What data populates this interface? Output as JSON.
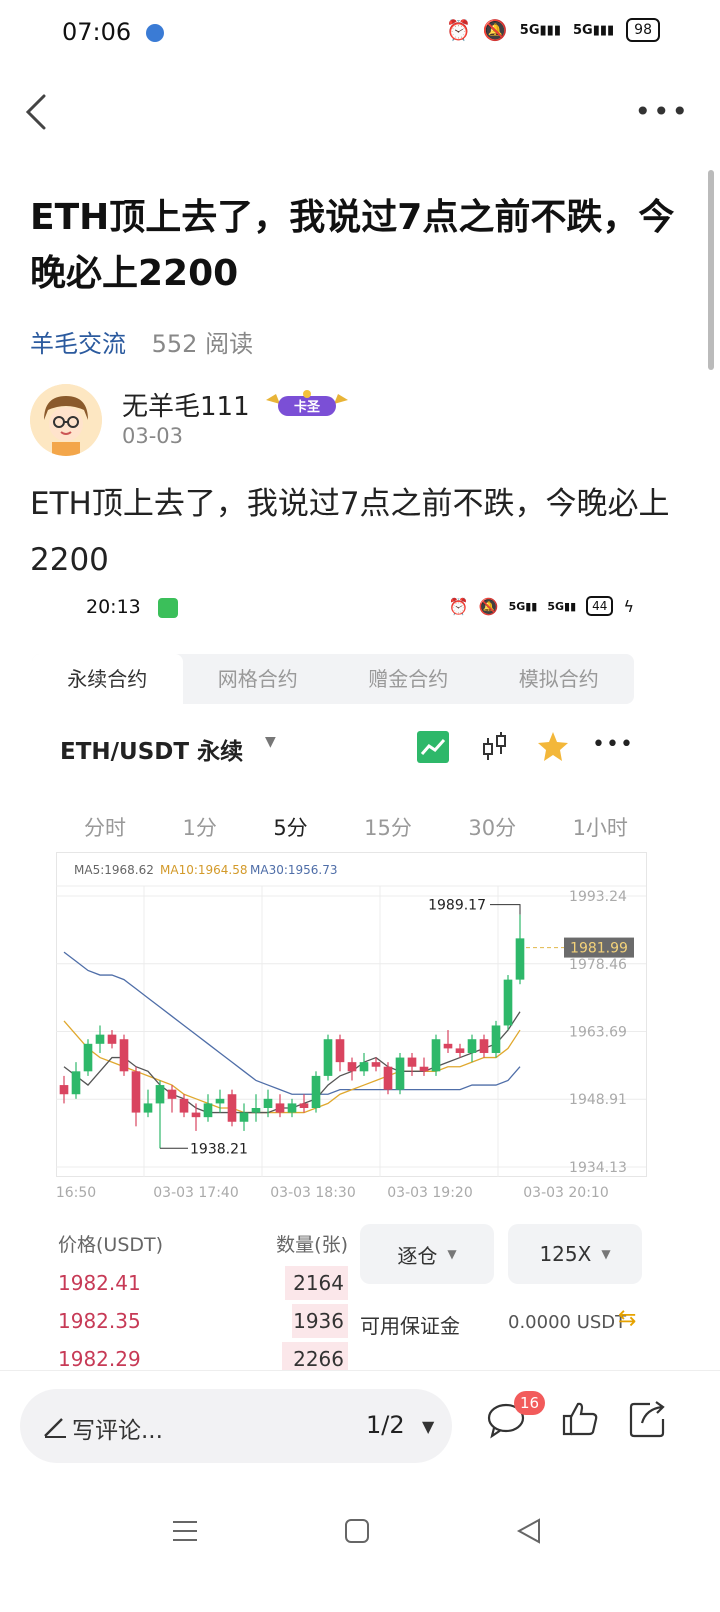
{
  "status_bar": {
    "time": "07:06",
    "signal_1": "5G",
    "signal_2": "5G",
    "battery": "98"
  },
  "post": {
    "title": "ETH顶上去了，我说过7点之前不跌，今晚必上2200",
    "topic": "羊毛交流",
    "reads": "552 阅读",
    "author": {
      "name": "无羊毛111",
      "badge": "卡圣",
      "date": "03-03"
    },
    "body": "ETH顶上去了，我说过7点之前不跌，今晚必上2200"
  },
  "embedded_screenshot": {
    "status_time": "20:13",
    "signal_1": "5G",
    "signal_2": "5G",
    "battery": "44",
    "contract_tabs": [
      "永续合约",
      "网格合约",
      "赠金合约",
      "模拟合约"
    ],
    "active_contract_tab": 0,
    "pair": "ETH/USDT 永续",
    "time_tabs": [
      "分时",
      "1分",
      "5分",
      "15分",
      "30分",
      "1小时"
    ],
    "active_time_tab": 2,
    "ma_labels": {
      "ma5": "MA5:1968.62",
      "ma10": "MA10:1964.58",
      "ma30": "MA30:1956.73"
    },
    "colors": {
      "up": "#2eb86a",
      "down": "#d9445f",
      "ma5": "#555555",
      "ma10": "#e0a82e",
      "ma30": "#4f6ea8"
    },
    "orderbook_header": {
      "price": "价格(USDT)",
      "qty": "数量(张)"
    },
    "orderbook": [
      {
        "price": "1982.41",
        "qty": "2164",
        "depth": 0.9
      },
      {
        "price": "1982.35",
        "qty": "1936",
        "depth": 0.8
      },
      {
        "price": "1982.29",
        "qty": "2266",
        "depth": 0.95
      }
    ],
    "margin_mode": "逐仓",
    "leverage": "125X",
    "available_margin_label": "可用保证金",
    "available_margin_value": "0.0000 USDT"
  },
  "chart_data": {
    "type": "candlestick",
    "y_ticks": [
      "1993.24",
      "1978.46",
      "1963.69",
      "1948.91",
      "1934.13"
    ],
    "ylim": [
      1934.13,
      1993.24
    ],
    "x_ticks": [
      "16:50",
      "03-03 17:40",
      "03-03 18:30",
      "03-03 19:20",
      "03-03 20:10"
    ],
    "last_price": "1981.99",
    "high_label": "1989.17",
    "low_label": "1938.21",
    "candles": [
      [
        1952,
        1950,
        1954,
        1948
      ],
      [
        1950,
        1955,
        1957,
        1949
      ],
      [
        1955,
        1961,
        1962,
        1954
      ],
      [
        1961,
        1963,
        1965,
        1959
      ],
      [
        1963,
        1961,
        1964,
        1960
      ],
      [
        1962,
        1955,
        1963,
        1954
      ],
      [
        1955,
        1946,
        1956,
        1943
      ],
      [
        1946,
        1948,
        1951,
        1945
      ],
      [
        1948,
        1952,
        1953,
        1938.21
      ],
      [
        1951,
        1949,
        1952,
        1946
      ],
      [
        1949,
        1946,
        1950,
        1945
      ],
      [
        1946,
        1945,
        1948,
        1942
      ],
      [
        1945,
        1948,
        1950,
        1944
      ],
      [
        1948,
        1949,
        1951,
        1946
      ],
      [
        1950,
        1944,
        1951,
        1943
      ],
      [
        1944,
        1946,
        1948,
        1942
      ],
      [
        1946,
        1947,
        1950,
        1944
      ],
      [
        1947,
        1949,
        1951,
        1945
      ],
      [
        1948,
        1946,
        1950,
        1945
      ],
      [
        1946,
        1948,
        1949,
        1945
      ],
      [
        1948,
        1947,
        1950,
        1946
      ],
      [
        1947,
        1954,
        1955,
        1946
      ],
      [
        1954,
        1962,
        1963,
        1953
      ],
      [
        1962,
        1957,
        1963,
        1955
      ],
      [
        1957,
        1955,
        1958,
        1953
      ],
      [
        1955,
        1957,
        1959,
        1954
      ],
      [
        1957,
        1956,
        1958,
        1955
      ],
      [
        1956,
        1951,
        1957,
        1950
      ],
      [
        1951,
        1958,
        1959,
        1950
      ],
      [
        1958,
        1956,
        1959,
        1954
      ],
      [
        1956,
        1955,
        1958,
        1954
      ],
      [
        1955,
        1962,
        1963,
        1954
      ],
      [
        1961,
        1960,
        1964,
        1959
      ],
      [
        1960,
        1959,
        1961,
        1958
      ],
      [
        1959,
        1962,
        1963,
        1957
      ],
      [
        1962,
        1959,
        1963,
        1958
      ],
      [
        1959,
        1965,
        1966,
        1958
      ],
      [
        1965,
        1975,
        1976,
        1964
      ],
      [
        1975,
        1984,
        1989.17,
        1974
      ]
    ],
    "ma5": [
      1956,
      1954,
      1952,
      1955,
      1958,
      1958,
      1956,
      1955,
      1952,
      1950,
      1949,
      1947,
      1946,
      1946,
      1946,
      1946,
      1946,
      1946,
      1947,
      1947,
      1948,
      1949,
      1952,
      1954,
      1955,
      1957,
      1958,
      1956,
      1955,
      1955,
      1955,
      1956,
      1957,
      1958,
      1959,
      1960,
      1961,
      1964,
      1968
    ],
    "ma10": [
      1966,
      1963,
      1960,
      1958,
      1957,
      1956,
      1955,
      1954,
      1953,
      1952,
      1950,
      1949,
      1948,
      1947,
      1947,
      1946,
      1946,
      1946,
      1946,
      1946,
      1946,
      1947,
      1948,
      1950,
      1951,
      1952,
      1953,
      1954,
      1955,
      1955,
      1955,
      1955,
      1956,
      1956,
      1957,
      1958,
      1958,
      1960,
      1964
    ],
    "ma30": [
      1981,
      1979,
      1977,
      1976,
      1976,
      1975,
      1973,
      1971,
      1969,
      1967,
      1965,
      1963,
      1961,
      1959,
      1957,
      1955,
      1953,
      1952,
      1951,
      1950,
      1950,
      1950,
      1950,
      1951,
      1951,
      1951,
      1951,
      1951,
      1951,
      1951,
      1951,
      1951,
      1951,
      1951,
      1952,
      1952,
      1952,
      1953,
      1956
    ]
  },
  "bottom_bar": {
    "comment_placeholder": "写评论...",
    "page_indicator": "1/2",
    "comment_count": "16"
  }
}
